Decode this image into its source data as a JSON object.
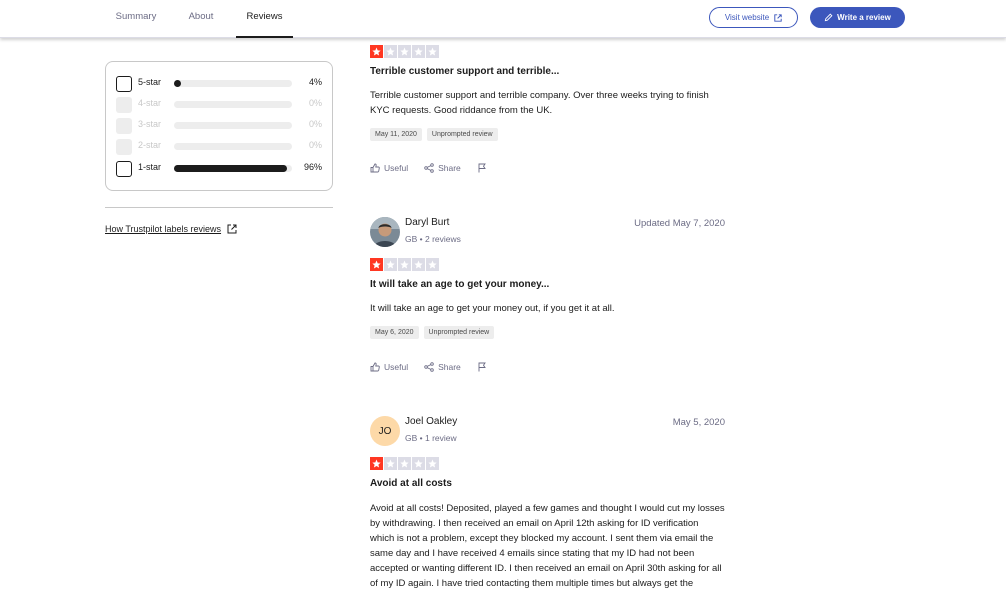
{
  "nav": {
    "tabs": [
      {
        "label": "Summary"
      },
      {
        "label": "About"
      },
      {
        "label": "Reviews"
      }
    ],
    "visit_label": "Visit website",
    "write_label": "Write a review"
  },
  "filters": [
    {
      "label": "5-star",
      "percent_text": "4%",
      "fraction": 0.04,
      "enabled": true
    },
    {
      "label": "4-star",
      "percent_text": "0%",
      "fraction": 0,
      "enabled": false
    },
    {
      "label": "3-star",
      "percent_text": "0%",
      "fraction": 0,
      "enabled": false
    },
    {
      "label": "2-star",
      "percent_text": "0%",
      "fraction": 0,
      "enabled": false
    },
    {
      "label": "1-star",
      "percent_text": "96%",
      "fraction": 0.96,
      "enabled": true
    }
  ],
  "labels_link": "How Trustpilot labels reviews",
  "actions": {
    "useful": "Useful",
    "share": "Share"
  },
  "reviews": [
    {
      "rating": 1,
      "title": "Terrible customer support and terrible...",
      "body": "Terrible customer support and terrible company. Over three weeks trying to finish KYC requests. Good riddance from the UK.",
      "experience_date": "May 11, 2020",
      "tag": "Unprompted review"
    },
    {
      "name": "Daryl Burt",
      "meta": "GB • 2 reviews",
      "date": "Updated May 7, 2020",
      "rating": 1,
      "title": "It will take an age to get your money...",
      "body": "It will take an age to get your money out, if you get it at all.",
      "experience_date": "May 6, 2020",
      "tag": "Unprompted review"
    },
    {
      "name": "Joel Oakley",
      "initials": "JO",
      "meta": "GB • 1 review",
      "date": "May 5, 2020",
      "rating": 1,
      "title": "Avoid at all costs",
      "body": "Avoid at all costs! Deposited, played a few games and thought I would cut my losses by withdrawing. I then received an email on April 12th asking for ID verification which is not a problem, except they blocked my account. I sent them via email the same day and I have received 4 emails since stating that my ID had not been accepted or wanting different ID. I then received an email on April 30th asking for all of my ID again. I have tried contacting them multiple times but always get the"
    }
  ],
  "colors": {
    "accent": "#3c57bc",
    "star_on": "#ff3722",
    "star_off": "#dcdce6"
  }
}
